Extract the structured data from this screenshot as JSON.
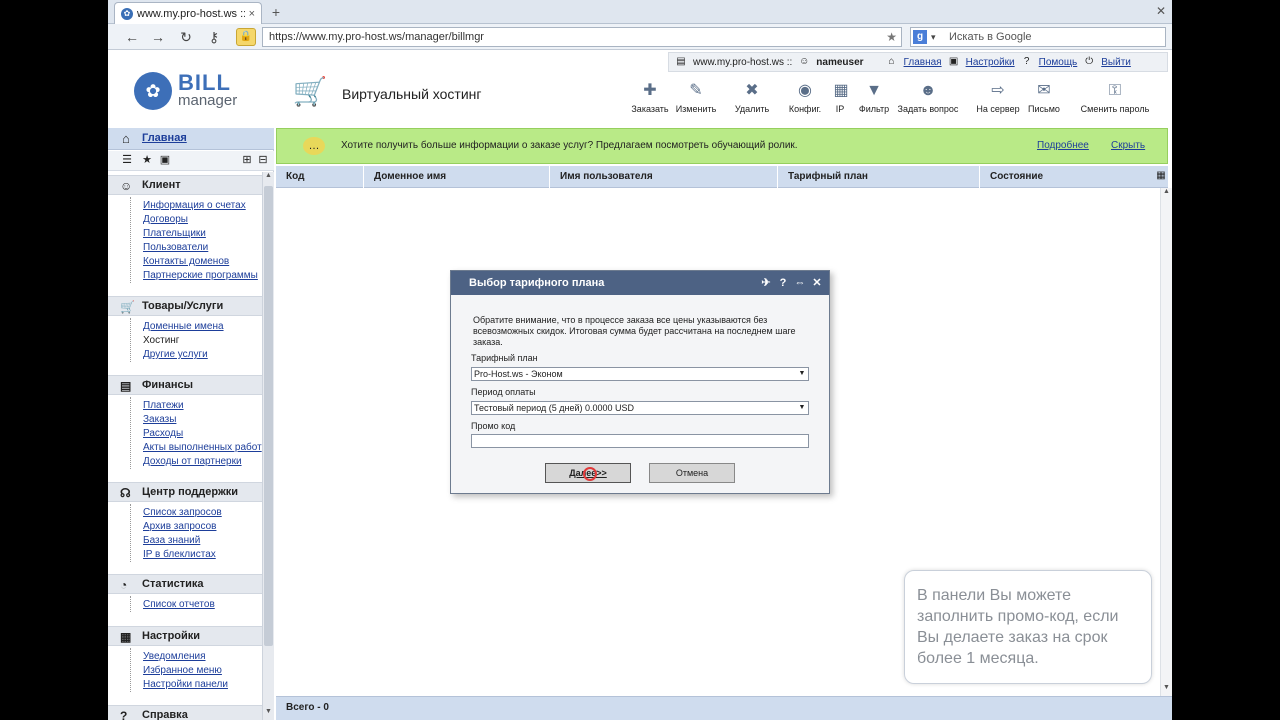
{
  "browser": {
    "tab_title": "www.my.pro-host.ws ::...",
    "tab_close": "×",
    "new_tab": "+",
    "url": "https://www.my.pro-host.ws/manager/billmgr",
    "search_placeholder": "Искать в Google"
  },
  "userbar": {
    "site": "www.my.pro-host.ws ::",
    "username": "nameuser",
    "links": [
      "Главная",
      "Настройки",
      "Помощь",
      "Выйти"
    ]
  },
  "logo": {
    "line1": "BILL",
    "line2": "manager"
  },
  "header": {
    "section_title": "Виртуальный хостинг"
  },
  "toolbar": [
    {
      "label": "Заказать",
      "icon": "order-icon"
    },
    {
      "label": "Изменить",
      "icon": "edit-icon"
    },
    {
      "label": "Удалить",
      "icon": "delete-icon"
    },
    {
      "label": "Конфиг.",
      "icon": "config-icon"
    },
    {
      "label": "IP",
      "icon": "ip-icon"
    },
    {
      "label": "Фильтр",
      "icon": "filter-icon"
    },
    {
      "label": "Задать вопрос",
      "icon": "question-icon"
    },
    {
      "label": "На сервер",
      "icon": "server-icon"
    },
    {
      "label": "Письмо",
      "icon": "mail-icon"
    },
    {
      "label": "Сменить пароль",
      "icon": "password-icon"
    }
  ],
  "sidebar": {
    "home": "Главная",
    "groups": [
      {
        "title": "Клиент",
        "icon": "client-icon",
        "items": [
          {
            "label": "Информация о счетах",
            "link": true
          },
          {
            "label": "Договоры",
            "link": true
          },
          {
            "label": "Плательщики",
            "link": true
          },
          {
            "label": "Пользователи",
            "link": true
          },
          {
            "label": "Контакты доменов",
            "link": true
          },
          {
            "label": "Партнерские программы",
            "link": true
          }
        ]
      },
      {
        "title": "Товары/Услуги",
        "icon": "cart-icon",
        "items": [
          {
            "label": "Доменные имена",
            "link": true
          },
          {
            "label": "Хостинг",
            "link": false
          },
          {
            "label": "Другие услуги",
            "link": true
          }
        ]
      },
      {
        "title": "Финансы",
        "icon": "finance-icon",
        "items": [
          {
            "label": "Платежи",
            "link": true
          },
          {
            "label": "Заказы",
            "link": true
          },
          {
            "label": "Расходы",
            "link": true
          },
          {
            "label": "Акты выполненных работ",
            "link": true
          },
          {
            "label": "Доходы от партнерки",
            "link": true
          }
        ]
      },
      {
        "title": "Центр поддержки",
        "icon": "headset-icon",
        "items": [
          {
            "label": "Список запросов",
            "link": true
          },
          {
            "label": "Архив запросов",
            "link": true
          },
          {
            "label": "База знаний",
            "link": true
          },
          {
            "label": "IP в блеклистах",
            "link": true
          }
        ]
      },
      {
        "title": "Статистика",
        "icon": "stats-icon",
        "items": [
          {
            "label": "Список отчетов",
            "link": true
          }
        ]
      },
      {
        "title": "Настройки",
        "icon": "settings-icon",
        "items": [
          {
            "label": "Уведомления",
            "link": true
          },
          {
            "label": "Избранное меню",
            "link": true
          },
          {
            "label": "Настройки панели",
            "link": true
          }
        ]
      },
      {
        "title": "Справка",
        "icon": "help-icon",
        "items": []
      }
    ]
  },
  "banner": {
    "text": "Хотите получить больше информации о заказе услуг? Предлагаем посмотреть обучающий ролик.",
    "more": "Подробнее",
    "hide": "Скрыть"
  },
  "table": {
    "columns": [
      "Код",
      "Доменное имя",
      "Имя пользователя",
      "Тарифный план",
      "Состояние"
    ],
    "footer": "Всего - 0"
  },
  "dialog": {
    "title": "Выбор тарифного плана",
    "note": "Обратите внимание, что в процессе заказа все цены указываются без всевозможных скидок. Итоговая сумма будет рассчитана на последнем шаге заказа.",
    "plan_label": "Тарифный план",
    "plan_value": "Pro-Host.ws - Эконом",
    "period_label": "Период оплаты",
    "period_value": "Тестовый период (5 дней) 0.0000 USD",
    "promo_label": "Промо код",
    "promo_value": "",
    "next_button": "Далее>>",
    "cancel_button": "Отмена"
  },
  "tooltip": {
    "text": "В панели Вы можете заполнить промо-код, если Вы делаете заказ на срок более 1 месяца."
  },
  "colors": {
    "header_blue": "#cfdcee",
    "banner_green": "#b9ea87",
    "dialog_title": "#4d6284",
    "link": "#1d3e9a"
  }
}
